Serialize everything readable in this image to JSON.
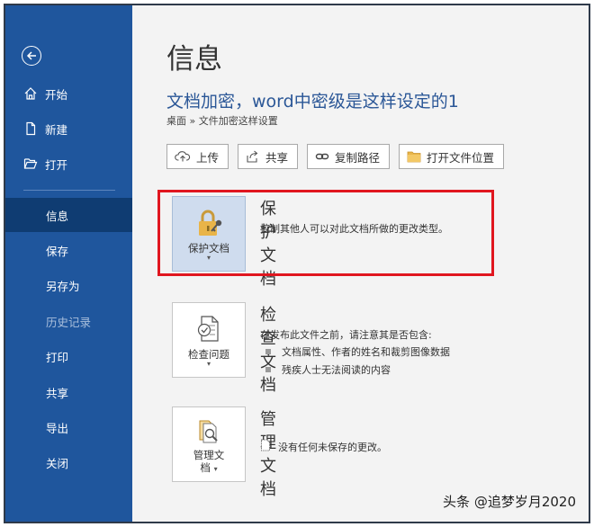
{
  "sidebar": {
    "items": [
      {
        "label": "开始",
        "icon": "home-icon"
      },
      {
        "label": "新建",
        "icon": "new-document-icon"
      },
      {
        "label": "打开",
        "icon": "open-folder-icon"
      },
      {
        "label": "信息",
        "active": true
      },
      {
        "label": "保存"
      },
      {
        "label": "另存为"
      },
      {
        "label": "历史记录",
        "disabled": true
      },
      {
        "label": "打印"
      },
      {
        "label": "共享"
      },
      {
        "label": "导出"
      },
      {
        "label": "关闭"
      }
    ]
  },
  "main": {
    "page_title": "信息",
    "doc_title": "文档加密，word中密级是这样设定的1",
    "breadcrumb": "桌面 » 文件加密这样设置",
    "actions": [
      {
        "label": "上传",
        "icon": "upload-cloud-icon"
      },
      {
        "label": "共享",
        "icon": "share-icon"
      },
      {
        "label": "复制路径",
        "icon": "link-icon"
      },
      {
        "label": "打开文件位置",
        "icon": "folder-icon"
      }
    ],
    "protect": {
      "tile_label": "保护文档",
      "title": "保护文档",
      "desc": "控制其他人可以对此文档所做的更改类型。"
    },
    "inspect": {
      "tile_label": "检查问题",
      "title": "检查文档",
      "desc": "在发布此文件之前，请注意其是否包含:",
      "bullets": [
        "文档属性、作者的姓名和裁剪图像数据",
        "残疾人士无法阅读的内容"
      ]
    },
    "manage": {
      "tile_label_1": "管理文",
      "tile_label_2": "档",
      "title": "管理文档",
      "desc": "没有任何未保存的更改。"
    }
  },
  "watermark": "头条 @追梦岁月2020",
  "colors": {
    "sidebar": "#1f569d",
    "sidebar_active": "#0f3c72",
    "accent_title": "#2b5797",
    "highlight": "#e0161f"
  }
}
